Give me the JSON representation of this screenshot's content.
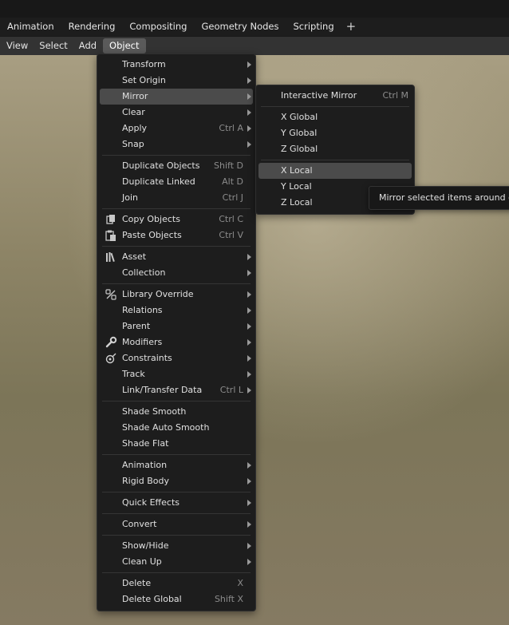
{
  "workspace_tabs": [
    "Animation",
    "Rendering",
    "Compositing",
    "Geometry Nodes",
    "Scripting"
  ],
  "add_tab_label": "+",
  "header_menu": [
    "View",
    "Select",
    "Add",
    "Object"
  ],
  "object_menu": {
    "items": [
      {
        "label": "Transform",
        "shortcut": "",
        "submenu": true
      },
      {
        "label": "Set Origin",
        "shortcut": "",
        "submenu": true
      },
      {
        "label": "Mirror",
        "shortcut": "",
        "submenu": true
      },
      {
        "label": "Clear",
        "shortcut": "",
        "submenu": true
      },
      {
        "label": "Apply",
        "shortcut": "Ctrl A",
        "submenu": true
      },
      {
        "label": "Snap",
        "shortcut": "",
        "submenu": true
      },
      {
        "label": "Duplicate Objects",
        "shortcut": "Shift D",
        "submenu": false
      },
      {
        "label": "Duplicate Linked",
        "shortcut": "Alt D",
        "submenu": false
      },
      {
        "label": "Join",
        "shortcut": "Ctrl J",
        "submenu": false
      },
      {
        "label": "Copy Objects",
        "shortcut": "Ctrl C",
        "submenu": false,
        "icon": "copy-icon"
      },
      {
        "label": "Paste Objects",
        "shortcut": "Ctrl V",
        "submenu": false,
        "icon": "paste-icon"
      },
      {
        "label": "Asset",
        "shortcut": "",
        "submenu": true,
        "icon": "asset-library-icon"
      },
      {
        "label": "Collection",
        "shortcut": "",
        "submenu": true
      },
      {
        "label": "Library Override",
        "shortcut": "",
        "submenu": true,
        "icon": "library-override-icon"
      },
      {
        "label": "Relations",
        "shortcut": "",
        "submenu": true
      },
      {
        "label": "Parent",
        "shortcut": "",
        "submenu": true
      },
      {
        "label": "Modifiers",
        "shortcut": "",
        "submenu": true,
        "icon": "wrench-icon"
      },
      {
        "label": "Constraints",
        "shortcut": "",
        "submenu": true,
        "icon": "constraint-icon"
      },
      {
        "label": "Track",
        "shortcut": "",
        "submenu": true
      },
      {
        "label": "Link/Transfer Data",
        "shortcut": "Ctrl L",
        "submenu": true
      },
      {
        "label": "Shade Smooth",
        "shortcut": "",
        "submenu": false
      },
      {
        "label": "Shade Auto Smooth",
        "shortcut": "",
        "submenu": false
      },
      {
        "label": "Shade Flat",
        "shortcut": "",
        "submenu": false
      },
      {
        "label": "Animation",
        "shortcut": "",
        "submenu": true
      },
      {
        "label": "Rigid Body",
        "shortcut": "",
        "submenu": true
      },
      {
        "label": "Quick Effects",
        "shortcut": "",
        "submenu": true
      },
      {
        "label": "Convert",
        "shortcut": "",
        "submenu": true
      },
      {
        "label": "Show/Hide",
        "shortcut": "",
        "submenu": true
      },
      {
        "label": "Clean Up",
        "shortcut": "",
        "submenu": true
      },
      {
        "label": "Delete",
        "shortcut": "X",
        "submenu": false
      },
      {
        "label": "Delete Global",
        "shortcut": "Shift X",
        "submenu": false
      }
    ]
  },
  "mirror_menu": {
    "items": [
      {
        "label": "Interactive Mirror",
        "shortcut": "Ctrl M"
      },
      {
        "label": "X Global",
        "shortcut": ""
      },
      {
        "label": "Y Global",
        "shortcut": ""
      },
      {
        "label": "Z Global",
        "shortcut": ""
      },
      {
        "label": "X Local",
        "shortcut": ""
      },
      {
        "label": "Y Local",
        "shortcut": ""
      },
      {
        "label": "Z Local",
        "shortcut": ""
      }
    ]
  },
  "tooltip": "Mirror selected items around on"
}
